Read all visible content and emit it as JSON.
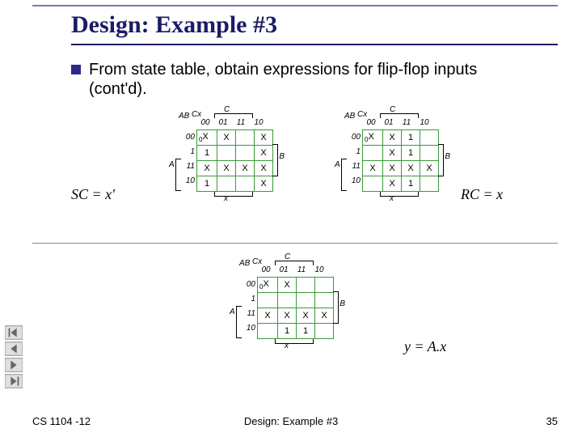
{
  "slide": {
    "title": "Design: Example #3",
    "bullet": "From state table, obtain expressions for flip-flop inputs (cont'd)."
  },
  "equations": {
    "sc": "SC = x'",
    "rc": "RC = x",
    "y": "y = A.x"
  },
  "labels": {
    "corner": "AB",
    "cx": "Cx",
    "C": "C",
    "A": "A",
    "B": "B",
    "x": "x",
    "cols": [
      "00",
      "01",
      "11",
      "10"
    ],
    "rows": [
      "00",
      "1",
      "11",
      "10"
    ]
  },
  "kmaps": {
    "sc": {
      "cells": [
        [
          "X",
          "X",
          "",
          "X"
        ],
        [
          "1",
          "",
          "",
          "X"
        ],
        [
          "X",
          "X",
          "X",
          "X"
        ],
        [
          "1",
          "",
          "",
          "X"
        ]
      ],
      "zero_cell": "0"
    },
    "rc": {
      "cells": [
        [
          "X",
          "X",
          "1",
          ""
        ],
        [
          "",
          "X",
          "1",
          ""
        ],
        [
          "X",
          "X",
          "X",
          "X"
        ],
        [
          "",
          "X",
          "1",
          ""
        ]
      ],
      "zero_cell": "0"
    },
    "y": {
      "cells": [
        [
          "X",
          "X",
          "",
          ""
        ],
        [
          "",
          "",
          "",
          ""
        ],
        [
          "X",
          "X",
          "X",
          "X"
        ],
        [
          "",
          "1",
          "1",
          ""
        ]
      ],
      "zero_cell": "0"
    }
  },
  "footer": {
    "left": "CS 1104 -12",
    "center": "Design: Example #3",
    "right": "35"
  },
  "chart_data": [
    {
      "type": "table",
      "title": "K-map for SC = x'",
      "row_var": "AB",
      "col_var": "Cx",
      "col_labels": [
        "00",
        "01",
        "11",
        "10"
      ],
      "row_labels": [
        "00",
        "01",
        "11",
        "10"
      ],
      "cells": [
        [
          "X",
          "X",
          "",
          "X"
        ],
        [
          "1",
          "",
          "",
          "X"
        ],
        [
          "X",
          "X",
          "X",
          "X"
        ],
        [
          "1",
          "",
          "",
          "X"
        ]
      ]
    },
    {
      "type": "table",
      "title": "K-map for RC = x",
      "row_var": "AB",
      "col_var": "Cx",
      "col_labels": [
        "00",
        "01",
        "11",
        "10"
      ],
      "row_labels": [
        "00",
        "01",
        "11",
        "10"
      ],
      "cells": [
        [
          "X",
          "X",
          "1",
          ""
        ],
        [
          "",
          "X",
          "1",
          ""
        ],
        [
          "X",
          "X",
          "X",
          "X"
        ],
        [
          "",
          "X",
          "1",
          ""
        ]
      ]
    },
    {
      "type": "table",
      "title": "K-map for y = A.x",
      "row_var": "AB",
      "col_var": "Cx",
      "col_labels": [
        "00",
        "01",
        "11",
        "10"
      ],
      "row_labels": [
        "00",
        "01",
        "11",
        "10"
      ],
      "cells": [
        [
          "X",
          "X",
          "",
          ""
        ],
        [
          "",
          "",
          "",
          ""
        ],
        [
          "X",
          "X",
          "X",
          "X"
        ],
        [
          "",
          "1",
          "1",
          ""
        ]
      ]
    }
  ]
}
